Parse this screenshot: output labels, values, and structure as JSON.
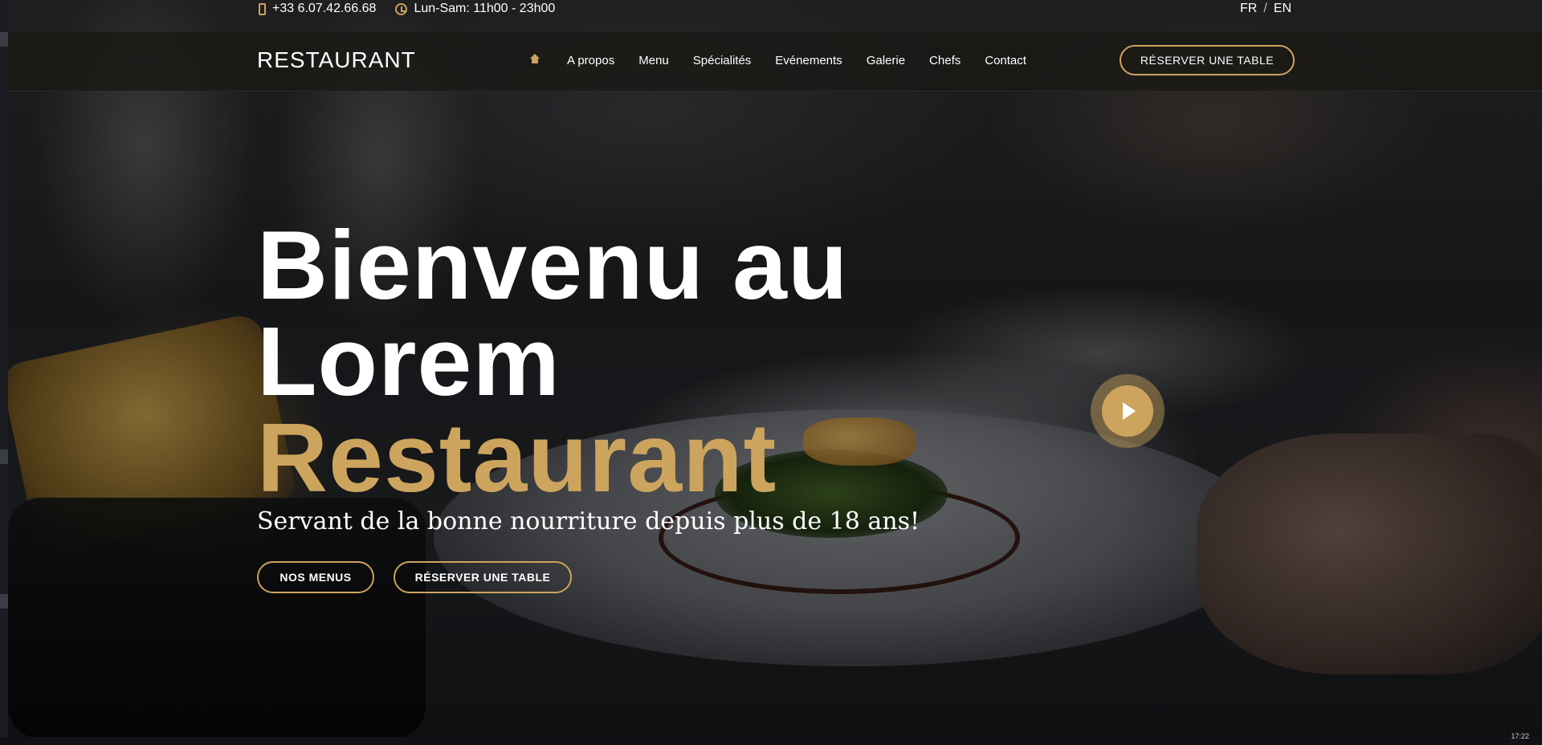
{
  "topbar": {
    "phone": "+33 6.07.42.66.68",
    "hours": "Lun-Sam: 11h00 - 23h00",
    "lang_fr": "FR",
    "lang_sep": "/",
    "lang_en": "EN"
  },
  "nav": {
    "logo": "RESTAURANT",
    "items": [
      "A propos",
      "Menu",
      "Spécialités",
      "Evénements",
      "Galerie",
      "Chefs",
      "Contact"
    ],
    "reserve_label": "RÉSERVER UNE TABLE"
  },
  "hero": {
    "title_line1": "Bienvenu au",
    "title_line2": "Lorem",
    "title_accent": "Restaurant",
    "tagline": "Servant de la bonne nourriture depuis plus de 18 ans!",
    "btn_menus": "NOS MENUS",
    "btn_reserve": "RÉSERVER UNE TABLE"
  },
  "taskbar": {
    "time": "17:22"
  },
  "colors": {
    "accent": "#cda45e",
    "nav_bg": "#1a1814"
  }
}
